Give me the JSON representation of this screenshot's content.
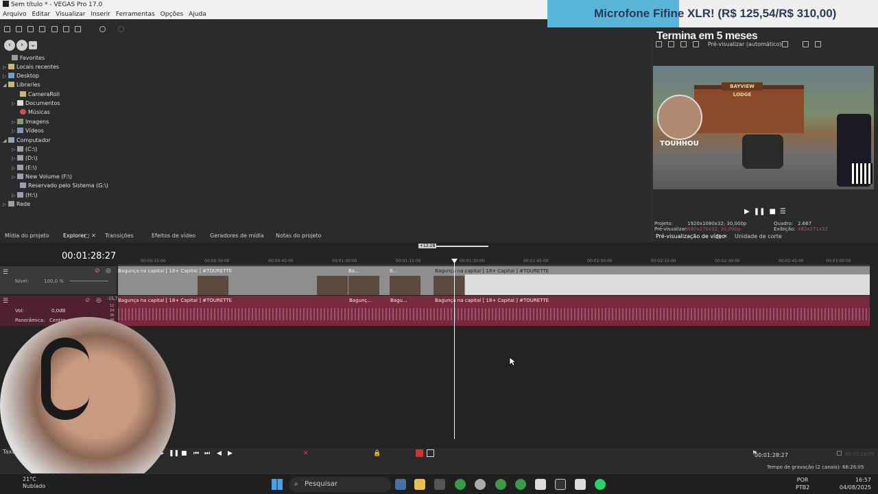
{
  "window": {
    "title": "Sem título * - VEGAS Pro 17.0"
  },
  "menu": [
    "Arquivo",
    "Editar",
    "Visualizar",
    "Inserir",
    "Ferramentas",
    "Opções",
    "Ajuda"
  ],
  "overlay": {
    "banner": "Microfone Fifine XLR! (R$ 125,54/R$ 310,00)",
    "subtitle": "Termina em 5 meses"
  },
  "explorer": {
    "tree": [
      {
        "label": "Favorites"
      },
      {
        "label": "Locais recentes"
      },
      {
        "label": "Desktop"
      },
      {
        "label": "Libraries"
      },
      {
        "label": "CameraRoll"
      },
      {
        "label": "Documentos"
      },
      {
        "label": "Músicas"
      },
      {
        "label": "Imagens"
      },
      {
        "label": "Vídeos"
      },
      {
        "label": "Computador"
      },
      {
        "label": "(C:\\)"
      },
      {
        "label": "(D:\\)"
      },
      {
        "label": "(E:\\)"
      },
      {
        "label": "New Volume (F:\\)"
      },
      {
        "label": "Reservado pelo Sistema (G:\\)"
      },
      {
        "label": "(H:\\)"
      },
      {
        "label": "Rede"
      }
    ]
  },
  "tabs": [
    "Mídia do projeto",
    "Explorer",
    "Transições",
    "Efeitos de vídeo",
    "Geradores de mídia",
    "Notas do projeto"
  ],
  "preview": {
    "mode": "Pré-visualizar (automático)",
    "sign": "BAYVIEW LODGE",
    "overlay_name": "TOUHHOU",
    "info": {
      "projeto_label": "Projeto:",
      "projeto": "1920x1080x32; 30,000p",
      "previsualizar_label": "Pré-visualizar:",
      "previsualizar": "480x270x32; 30,000p",
      "quadro_label": "Quadro:",
      "quadro": "2.667",
      "exibicao_label": "Exibição:",
      "exibicao": "482x271x32"
    },
    "tabs": [
      "Pré-visualização de vídeo",
      "Unidade de corte"
    ]
  },
  "timeline": {
    "timecode": "00:01:28:27",
    "zoom_label": "+12:28",
    "ruler": [
      "00:00:15:00",
      "00:00:30:00",
      "00:00:45:00",
      "00:01:00:00",
      "00:01:15:00",
      "00:01:30:00",
      "00:01:45:00",
      "00:02:00:00",
      "00:02:15:00",
      "00:02:30:00",
      "00:02:45:00",
      "00:03:00:00"
    ],
    "video_track": {
      "level_label": "Nível:",
      "level": "100,0 %"
    },
    "audio_track": {
      "vol_label": "Vol:",
      "vol": "0,0dB",
      "pan_label": "Panorâmica:",
      "pan": "Centro",
      "meter_top": "-15,7",
      "meter_marks": [
        "12",
        "24",
        "36",
        "48"
      ]
    },
    "clip_title": "Bagunça na capital  [ 18+ Capital ] #TOURETTE",
    "short_clip_1": "Bagunç...",
    "short_clip_2": "Bagu...",
    "short_clip_3": "Ba...",
    "short_clip_4": "B...",
    "rate_label": "Taxa:"
  },
  "status": {
    "cursor_time": "00:01:28:27",
    "end_time": "00:03:23:05",
    "recording": "Tempo de gravação (2 canais): 66:26:05"
  },
  "taskbar": {
    "temp": "21°C",
    "weather": "Nublado",
    "search": "Pesquisar",
    "lang1": "POR",
    "lang2": "PTB2",
    "time": "16:57",
    "date": "04/08/2025"
  }
}
